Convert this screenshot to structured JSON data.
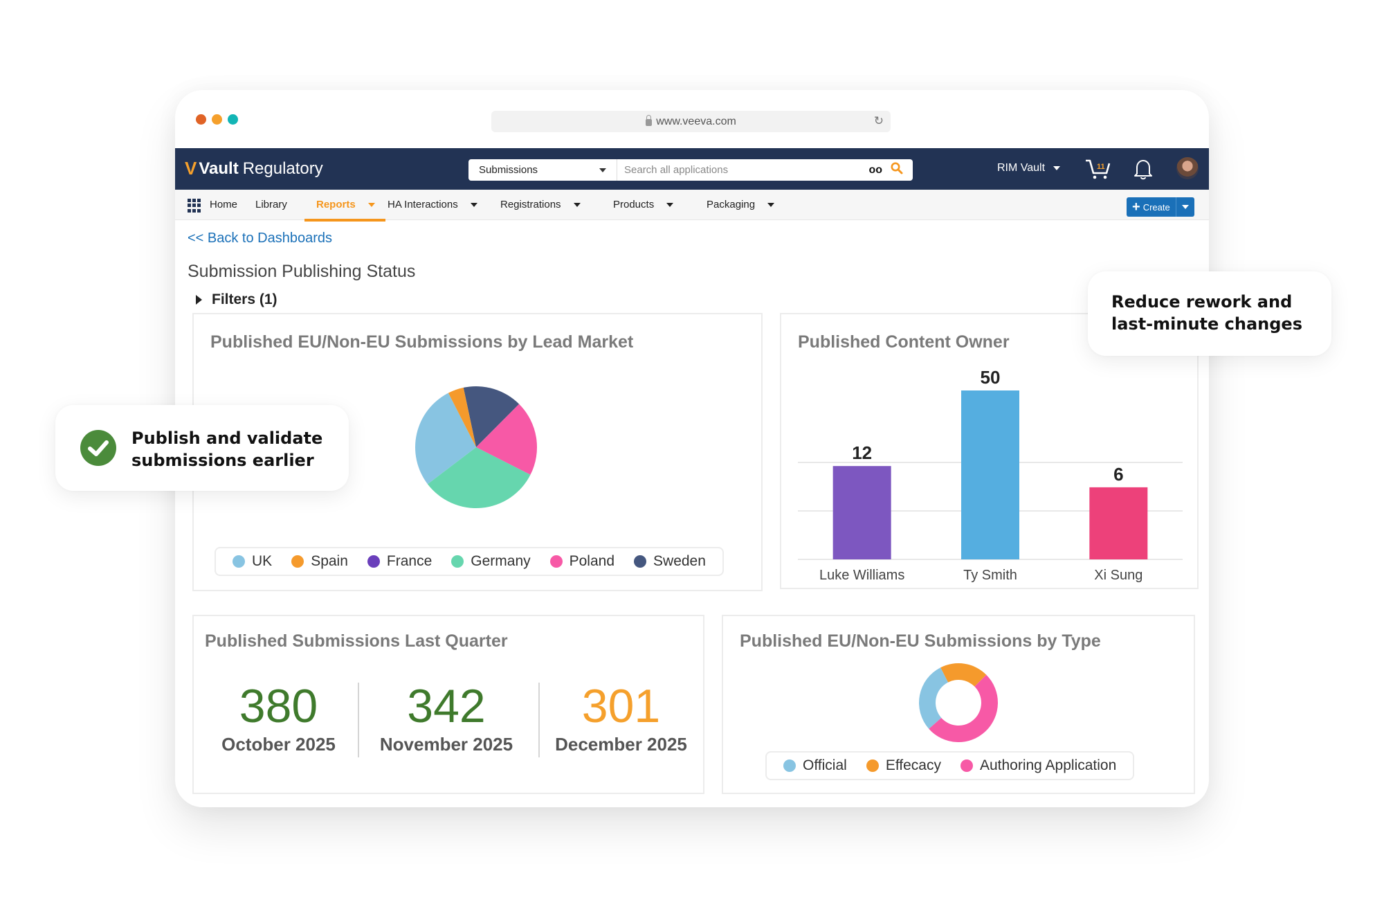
{
  "browser": {
    "window_dots": [
      "#e06326",
      "#f5a02c",
      "#12b5b5"
    ],
    "url": "www.veeva.com"
  },
  "header": {
    "app_name_bold": "Vault",
    "app_name_rest": "Regulatory",
    "search_scope": "Submissions",
    "search_placeholder": "Search all applications",
    "vault_selector": "RIM Vault",
    "cart_count": "11"
  },
  "nav": {
    "items": [
      {
        "label": "Home",
        "dropdown": false,
        "active": false
      },
      {
        "label": "Library",
        "dropdown": false,
        "active": false
      },
      {
        "label": "Reports",
        "dropdown": true,
        "active": true
      },
      {
        "label": "HA Interactions",
        "dropdown": true,
        "active": false
      },
      {
        "label": "Registrations",
        "dropdown": true,
        "active": false
      },
      {
        "label": "Products",
        "dropdown": true,
        "active": false
      },
      {
        "label": "Packaging",
        "dropdown": true,
        "active": false
      }
    ],
    "create_label": "Create"
  },
  "page": {
    "back_link": "<< Back to Dashboards",
    "title": "Submission Publishing Status",
    "filters_label": "Filters (1)"
  },
  "cards": {
    "lead_market_title": "Published EU/Non-EU Submissions by Lead Market",
    "content_owner_title": "Published Content Owner",
    "last_quarter_title": "Published Submissions Last Quarter",
    "by_type_title": "Published EU/Non-EU Submissions by Type"
  },
  "last_quarter": [
    {
      "value": "380",
      "label": "October 2025",
      "color": "#3f7a2c"
    },
    {
      "value": "342",
      "label": "November 2025",
      "color": "#3f7a2c"
    },
    {
      "value": "301",
      "label": "December 2025",
      "color": "#f5a02c"
    }
  ],
  "callouts": {
    "left": "Publish and validate submissions earlier",
    "left_line1": "Publish and validate",
    "left_line2": "submissions earlier",
    "right_line1": "Reduce rework and",
    "right_line2": "last-minute changes",
    "check_color": "#4b8b3b"
  },
  "chart_data": [
    {
      "type": "pie",
      "title": "Published EU/Non-EU Submissions by Lead Market",
      "unit": "percent (estimated from slice angles)",
      "legend_position": "bottom",
      "categories": [
        "UK",
        "Spain",
        "France",
        "Germany",
        "Poland",
        "Sweden"
      ],
      "values": [
        27.8,
        4.2,
        0,
        32.2,
        20.0,
        15.8
      ],
      "colors": [
        "#88c4e2",
        "#f59a2c",
        "#6a3fbb",
        "#66d6ae",
        "#f759a6",
        "#45577f"
      ],
      "draw_order": [
        "Sweden",
        "Poland",
        "Germany",
        "UK",
        "Spain"
      ]
    },
    {
      "type": "bar",
      "title": "Published Content Owner",
      "categories": [
        "Luke Williams",
        "Ty Smith",
        "Xi Sung"
      ],
      "values": [
        12,
        50,
        6
      ],
      "colors": [
        "#7d57c0",
        "#55aee0",
        "#ed417a"
      ],
      "data_labels": true,
      "grid": true
    },
    {
      "type": "pie",
      "donut": true,
      "title": "Published EU/Non-EU Submissions by Type",
      "unit": "percent (estimated from slice angles)",
      "legend_position": "bottom",
      "categories": [
        "Official",
        "Effecacy",
        "Authoring Application"
      ],
      "values": [
        29,
        20,
        51
      ],
      "colors": [
        "#88c4e2",
        "#f59a2c",
        "#f759a6"
      ],
      "draw_order": [
        "Effecacy",
        "Authoring Application",
        "Official"
      ]
    }
  ]
}
